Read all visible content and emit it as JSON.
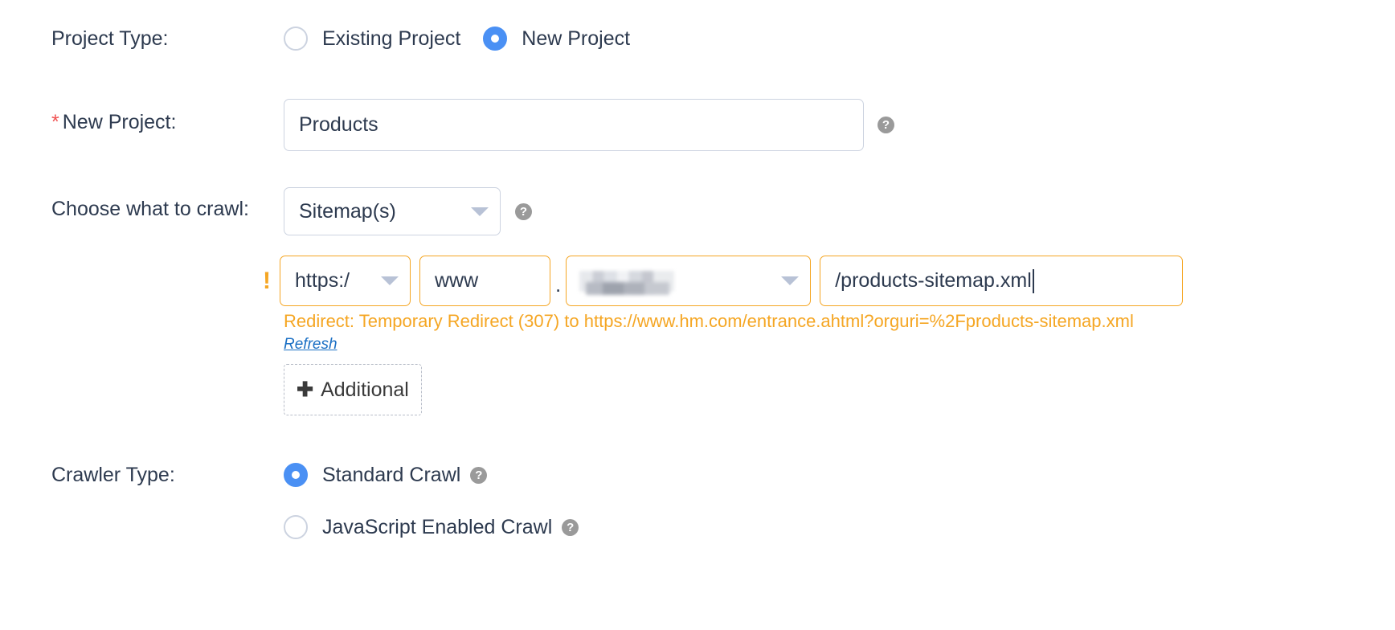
{
  "project_type": {
    "label": "Project Type:",
    "options": [
      {
        "label": "Existing Project",
        "selected": false
      },
      {
        "label": "New Project",
        "selected": true
      }
    ]
  },
  "new_project": {
    "required_marker": "*",
    "label": "New Project:",
    "value": "Products",
    "placeholder": "",
    "help_icon": "question-mark-icon",
    "help_glyph": "?"
  },
  "choose_crawl": {
    "label": "Choose what to crawl:",
    "selected": "Sitemap(s)",
    "caret_icon": "chevron-down-icon",
    "help_icon": "question-mark-icon",
    "help_glyph": "?"
  },
  "url_row": {
    "warning_glyph": "!",
    "warning_icon": "exclamation-icon",
    "protocol": {
      "value": "https:/",
      "caret_icon": "chevron-down-icon"
    },
    "subdomain": {
      "value": "www"
    },
    "separator": ".",
    "domain": {
      "value": "",
      "redacted": true,
      "caret_icon": "chevron-down-icon"
    },
    "path": {
      "value": "/products-sitemap.xml",
      "has_cursor": true
    },
    "message": "Redirect: Temporary Redirect (307) to https://www.hm.com/entrance.ahtml?orguri=%2Fproducts-sitemap.xml",
    "refresh_label": "Refresh"
  },
  "additional": {
    "plus_glyph": "✚",
    "label": "Additional"
  },
  "crawler_type": {
    "label": "Crawler Type:",
    "options": [
      {
        "label": "Standard Crawl",
        "selected": true,
        "help_glyph": "?"
      },
      {
        "label": "JavaScript Enabled Crawl",
        "selected": false,
        "help_glyph": "?"
      }
    ]
  },
  "colors": {
    "accent_blue": "#4a90f4",
    "warning_orange": "#f5a623",
    "link_blue": "#1a6fc4",
    "required_red": "#f05252",
    "text_dark": "#2d3a4f",
    "border_gray": "#ccd3e0"
  }
}
